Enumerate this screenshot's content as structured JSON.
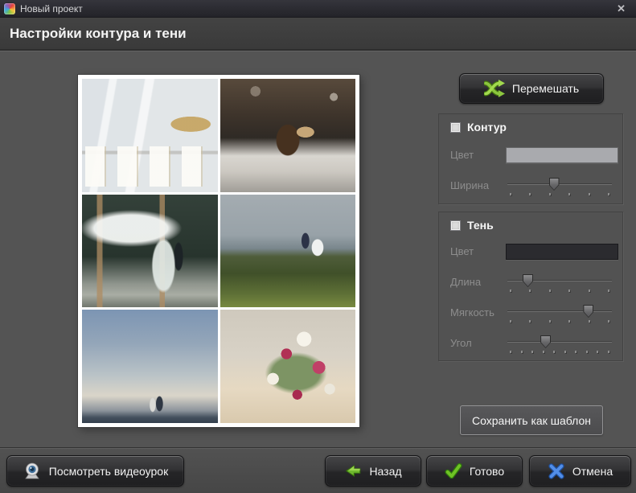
{
  "window": {
    "title": "Новый проект",
    "close_glyph": "✕"
  },
  "header": {
    "title": "Настройки контура и тени"
  },
  "preview": {
    "photos": [
      {
        "description": "wedding table with numbered place cards"
      },
      {
        "description": "pine cone with name tag on books"
      },
      {
        "description": "bride with flowing veil by green wall"
      },
      {
        "description": "couple walking on a hillside"
      },
      {
        "description": "couple against a clear sky"
      },
      {
        "description": "wedding bouquets on banquet table"
      }
    ]
  },
  "panel": {
    "shuffle_label": "Перемешать",
    "contour": {
      "title": "Контур",
      "checked": false,
      "color_label": "Цвет",
      "color_value": "#a9aaae",
      "width": {
        "label": "Ширина",
        "percent": 45,
        "ticks": 6
      }
    },
    "shadow": {
      "title": "Тень",
      "checked": false,
      "color_label": "Цвет",
      "color_value": "#2b2b2f",
      "sliders": [
        {
          "label": "Длина",
          "percent": 20,
          "ticks": 6
        },
        {
          "label": "Мягкость",
          "percent": 78,
          "ticks": 6
        },
        {
          "label": "Угол",
          "percent": 37,
          "ticks": 10
        }
      ]
    },
    "save_template_label": "Сохранить как шаблон"
  },
  "footer": {
    "video_label": "Посмотреть видеоурок",
    "back_label": "Назад",
    "done_label": "Готово",
    "cancel_label": "Отмена"
  },
  "colors": {
    "accent_green": "#7cb82f",
    "accent_blue": "#4d8ae8"
  }
}
